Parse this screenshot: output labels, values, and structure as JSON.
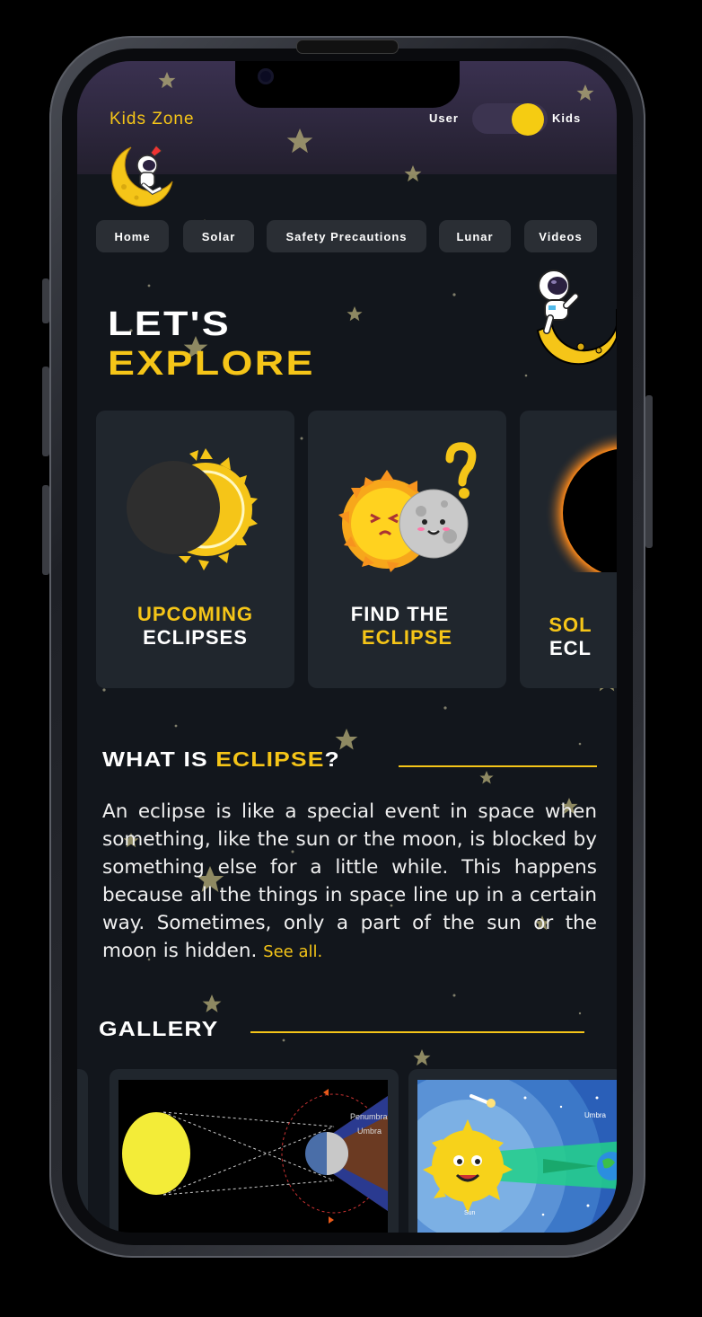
{
  "header": {
    "brand": "Kids Zone",
    "toggle": {
      "left_label": "User",
      "right_label": "Kids",
      "state": "Kids"
    }
  },
  "nav": [
    {
      "label": "Home"
    },
    {
      "label": "Solar"
    },
    {
      "label": "Safety Precautions"
    },
    {
      "label": "Lunar"
    },
    {
      "label": "Videos"
    }
  ],
  "hero": {
    "line1": "LET'S",
    "line2": "EXPLORE"
  },
  "cards": [
    {
      "line1": "UPCOMING",
      "line2": "ECLIPSES"
    },
    {
      "line1": "FIND THE",
      "line2": "ECLIPSE"
    },
    {
      "line1": "SOL",
      "line2": "ECL"
    }
  ],
  "what_is": {
    "title_prefix": "WHAT IS ",
    "title_highlight": "ECLIPSE",
    "title_suffix": "?",
    "body": "An eclipse is like a special event in space when something, like the sun or the moon, is blocked by something else for a little while. This happens because all the things in space line up in a certain way. Sometimes, only a part of the sun or the moon is hidden.",
    "link": "See all."
  },
  "gallery": {
    "title": "GALLERY",
    "items": [
      {
        "labels": [
          "Penumbra",
          "Umbra"
        ]
      },
      {
        "labels": [
          "Umbra",
          "Sun"
        ]
      }
    ]
  },
  "colors": {
    "accent": "#f5c518",
    "background": "#12161c",
    "card": "#20262d",
    "header": "#2d2740"
  }
}
